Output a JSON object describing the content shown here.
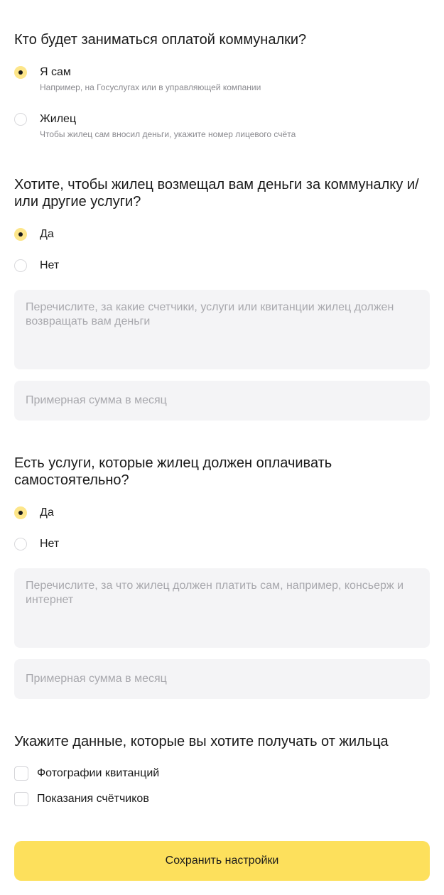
{
  "payment_section": {
    "title": "Кто будет заниматься оплатой коммуналки?",
    "options": [
      {
        "label": "Я сам",
        "hint": "Например, на Госуслугах или в управляющей компании",
        "selected": true
      },
      {
        "label": "Жилец",
        "hint": "Чтобы жилец сам вносил деньги, укажите номер лицевого счёта",
        "selected": false
      }
    ]
  },
  "reimburse_section": {
    "title": "Хотите, чтобы жилец возмещал вам деньги за коммуналку и/или другие услуги?",
    "options": [
      {
        "label": "Да",
        "selected": true
      },
      {
        "label": "Нет",
        "selected": false
      }
    ],
    "details_placeholder": "Перечислите, за какие счетчики, услуги или квитанции жилец должен возвращать вам деньги",
    "details_value": "",
    "amount_placeholder": "Примерная сумма в месяц",
    "amount_value": ""
  },
  "self_pay_section": {
    "title": "Есть услуги, которые жилец должен оплачивать самостоятельно?",
    "options": [
      {
        "label": "Да",
        "selected": true
      },
      {
        "label": "Нет",
        "selected": false
      }
    ],
    "details_placeholder": "Перечислите, за что жилец должен платить сам, например, консьерж и интернет",
    "details_value": "",
    "amount_placeholder": "Примерная сумма в месяц",
    "amount_value": ""
  },
  "data_section": {
    "title": "Укажите данные, которые вы хотите получать от жильца",
    "checkboxes": [
      {
        "label": "Фотографии квитанций",
        "checked": false
      },
      {
        "label": "Показания счётчиков",
        "checked": false
      }
    ]
  },
  "save_button": {
    "label": "Сохранить настройки"
  },
  "colors": {
    "accent": "#fde05c",
    "radio_checked_fill": "#fde68a",
    "field_background": "#f4f4f6",
    "placeholder_text": "#a8a8ad",
    "hint_text": "#8a8a8f"
  }
}
